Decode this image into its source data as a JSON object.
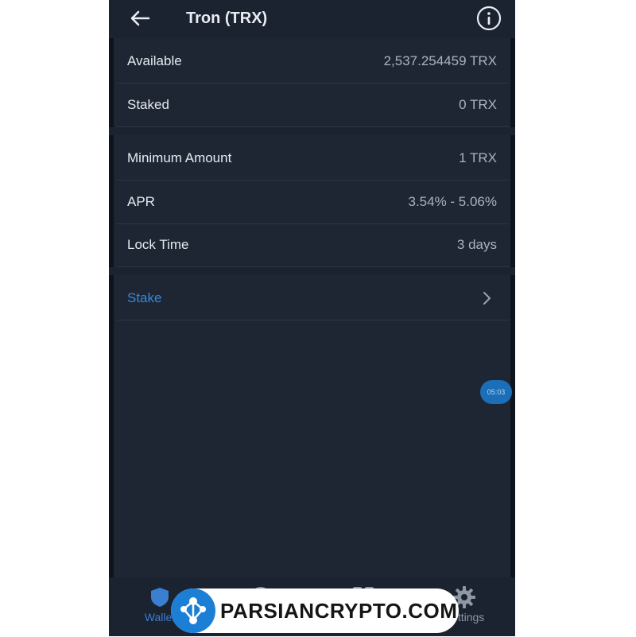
{
  "header": {
    "title": "Tron (TRX)",
    "back_icon": "arrow-left-icon",
    "info_icon": "info-icon"
  },
  "balances": [
    {
      "label": "Available",
      "value": "2,537.254459 TRX"
    },
    {
      "label": "Staked",
      "value": "0 TRX"
    }
  ],
  "details": [
    {
      "label": "Minimum Amount",
      "value": "1 TRX"
    },
    {
      "label": "APR",
      "value": "3.54% - 5.06%"
    },
    {
      "label": "Lock Time",
      "value": "3 days"
    }
  ],
  "actions": {
    "stake_label": "Stake",
    "chevron_icon": "chevron-right-icon"
  },
  "timer": {
    "value": "05:03"
  },
  "tabbar": {
    "tabs": [
      {
        "label": "Wallet",
        "icon": "shield-icon",
        "active": true
      },
      {
        "label": "",
        "icon": "compass-icon",
        "active": false
      },
      {
        "label": "",
        "icon": "grid-icon",
        "active": false
      },
      {
        "label": "Settings",
        "icon": "gear-icon",
        "active": false
      }
    ]
  },
  "watermark": {
    "text": "PARSIANCRYPTO.COM"
  },
  "colors": {
    "background": "#1e2634",
    "header": "#1b2230",
    "accent": "#3a86d6",
    "text": "#e6eaef",
    "muted": "#aab3bf"
  }
}
